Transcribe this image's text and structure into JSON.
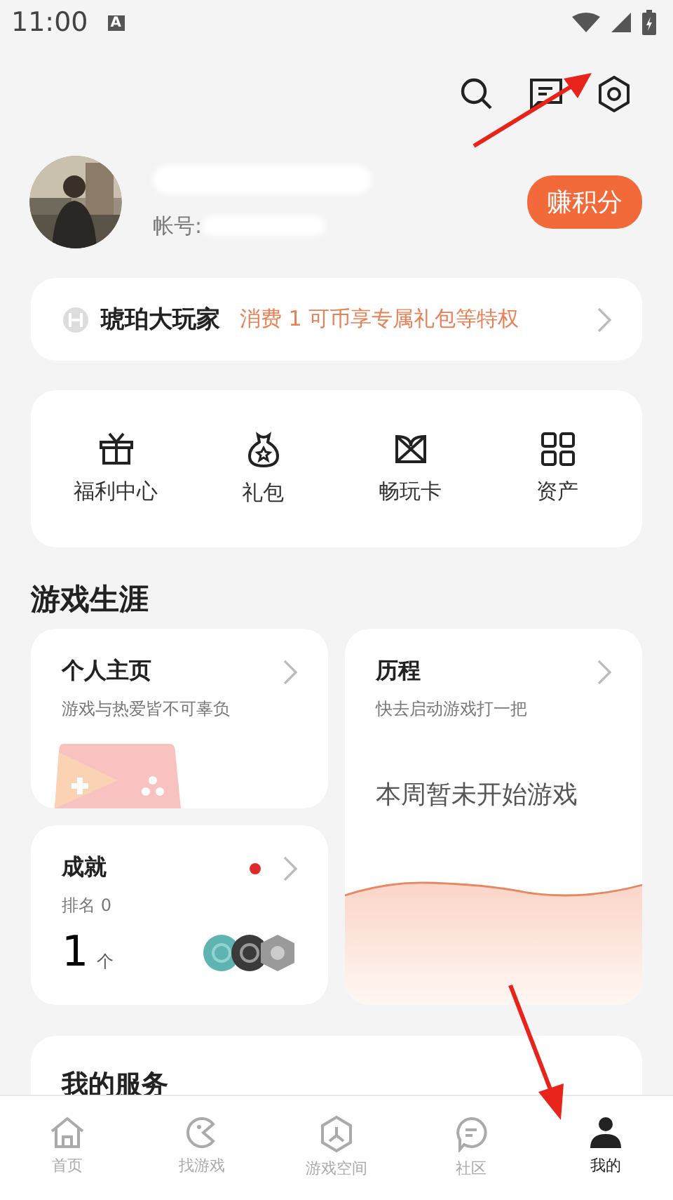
{
  "status_bar": {
    "time": "11:00",
    "ime_badge": "A"
  },
  "profile": {
    "account_label": "帐号:",
    "earn_button": "赚积分"
  },
  "membership": {
    "level": "琥珀大玩家",
    "promo": "消费 1 可币享专属礼包等特权"
  },
  "shortcuts": [
    {
      "kind": "gift",
      "label": "福利中心"
    },
    {
      "kind": "bag",
      "label": "礼包"
    },
    {
      "kind": "card",
      "label": "畅玩卡"
    },
    {
      "kind": "grid",
      "label": "资产"
    }
  ],
  "career": {
    "title": "游戏生涯",
    "homepage": {
      "title": "个人主页",
      "subtitle": "游戏与热爱皆不可辜负"
    },
    "achievements": {
      "title": "成就",
      "rank": "排名 0",
      "count": "1",
      "unit": "个",
      "unread": true
    },
    "history": {
      "title": "历程",
      "subtitle": "快去启动游戏打一把",
      "empty_text": "本周暂未开始游戏"
    }
  },
  "services": {
    "title": "我的服务"
  },
  "tabs": [
    {
      "kind": "home",
      "label": "首页",
      "selected": false
    },
    {
      "kind": "find",
      "label": "找游戏",
      "selected": false
    },
    {
      "kind": "space",
      "label": "游戏空间",
      "selected": false
    },
    {
      "kind": "community",
      "label": "社区",
      "selected": false
    },
    {
      "kind": "me",
      "label": "我的",
      "selected": true
    }
  ]
}
